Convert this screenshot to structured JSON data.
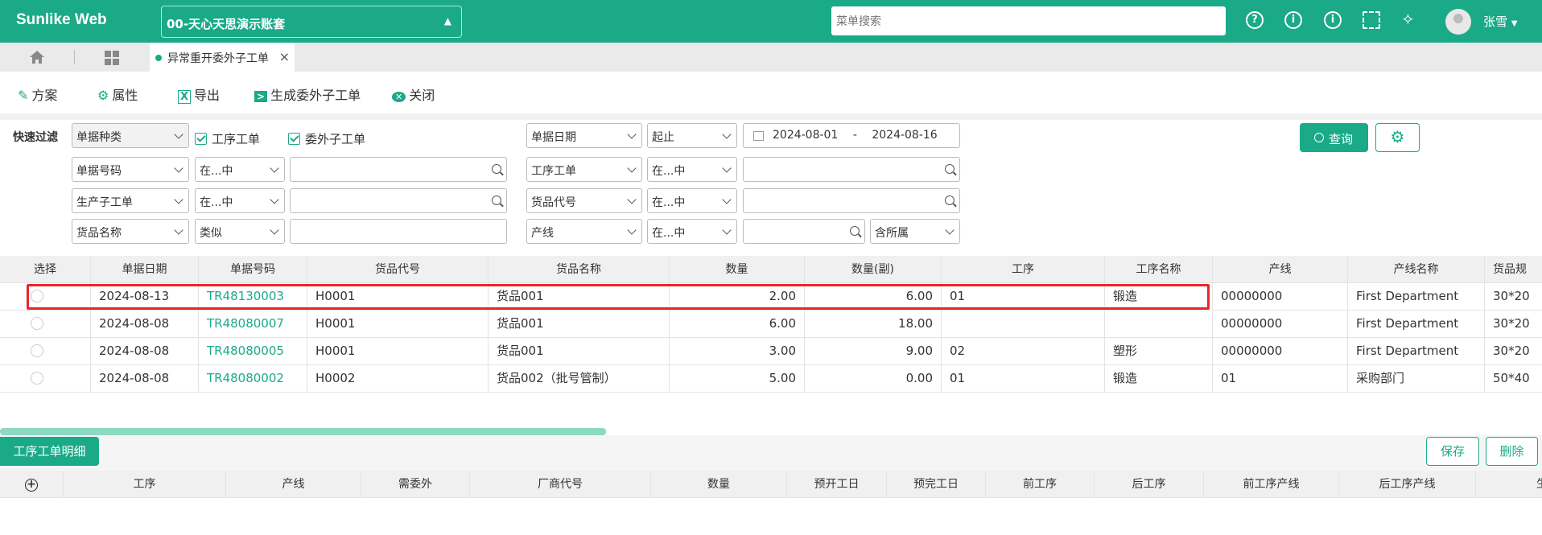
{
  "topbar": {
    "brand": "Sunlike Web",
    "account": "00-天心天思演示账套",
    "menu_search_placeholder": "菜单搜索",
    "username": "张雪",
    "accent": "#1aaa87"
  },
  "tabs": {
    "active_label": "异常重开委外子工单"
  },
  "toolbar": {
    "scheme": "方案",
    "properties": "属性",
    "export": "导出",
    "generate": "生成委外子工单",
    "close": "关闭"
  },
  "filters": {
    "quick_filter_label": "快速过滤",
    "doc_kind": "单据种类",
    "chk_process_order": "工序工单",
    "chk_outsource_order": "委外子工单",
    "doc_date": "单据日期",
    "range_mode": "起止",
    "date_from": "2024-08-01",
    "date_sep": "-",
    "date_to": "2024-08-16",
    "query_button": "查询",
    "r2_field_left": "单据号码",
    "r2_op_left": "在...中",
    "r2_field_right": "工序工单",
    "r2_op_right": "在...中",
    "r3_field_left": "生产子工单",
    "r3_op_left": "在...中",
    "r3_field_right": "货品代号",
    "r3_op_right": "在...中",
    "r4_field_left": "货品名称",
    "r4_op_left": "类似",
    "r4_field_right": "产线",
    "r4_op_right": "在...中",
    "r4_extra": "含所属"
  },
  "grid": {
    "columns": [
      "选择",
      "单据日期",
      "单据号码",
      "货品代号",
      "货品名称",
      "数量",
      "数量(副)",
      "工序",
      "工序名称",
      "产线",
      "产线名称",
      "货品规"
    ],
    "rows": [
      {
        "date": "2024-08-13",
        "no": "TR48130003",
        "code": "H0001",
        "name": "货品001",
        "qty": "2.00",
        "qty2": "6.00",
        "proc": "01",
        "procname": "锻造",
        "line": "00000000",
        "linename": "First Department",
        "spec": "30*20"
      },
      {
        "date": "2024-08-08",
        "no": "TR48080007",
        "code": "H0001",
        "name": "货品001",
        "qty": "6.00",
        "qty2": "18.00",
        "proc": "",
        "procname": "",
        "line": "00000000",
        "linename": "First Department",
        "spec": "30*20"
      },
      {
        "date": "2024-08-08",
        "no": "TR48080005",
        "code": "H0001",
        "name": "货品001",
        "qty": "3.00",
        "qty2": "9.00",
        "proc": "02",
        "procname": "塑形",
        "line": "00000000",
        "linename": "First Department",
        "spec": "30*20"
      },
      {
        "date": "2024-08-08",
        "no": "TR48080002",
        "code": "H0002",
        "name": "货品002（批号管制）",
        "qty": "5.00",
        "qty2": "0.00",
        "proc": "01",
        "procname": "锻造",
        "line": "01",
        "linename": "采购部门",
        "spec": "50*40"
      }
    ]
  },
  "detail": {
    "tab_label": "工序工单明细",
    "save": "保存",
    "delete": "删除",
    "columns": [
      "工序",
      "产线",
      "需委外",
      "厂商代号",
      "数量",
      "预开工日",
      "预完工日",
      "前工序",
      "后工序",
      "前工序产线",
      "后工序产线",
      "生"
    ]
  }
}
